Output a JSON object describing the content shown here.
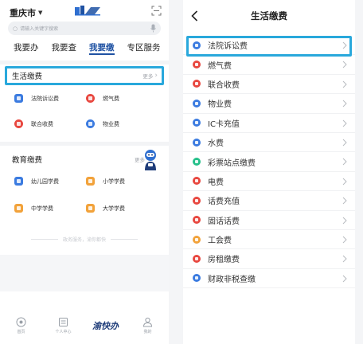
{
  "left": {
    "city": "重庆市",
    "search_placeholder": "请输入关键字搜索",
    "tabs": [
      "我要办",
      "我要查",
      "我要缴",
      "专区服务"
    ],
    "active_tab": 2,
    "life": {
      "title": "生活缴费",
      "more": "更多",
      "items": [
        {
          "label": "法院诉讼费",
          "color": "#3b7be0"
        },
        {
          "label": "燃气费",
          "color": "#e8473f"
        },
        {
          "label": "联合收费",
          "color": "#e8473f"
        },
        {
          "label": "物业费",
          "color": "#3b7be0"
        }
      ]
    },
    "edu": {
      "title": "教育缴费",
      "more": "更多",
      "items": [
        {
          "label": "幼儿园学费",
          "color": "#3b7be0"
        },
        {
          "label": "小学学费",
          "color": "#f2a23a"
        },
        {
          "label": "中学学费",
          "color": "#f2a23a"
        },
        {
          "label": "大学学费",
          "color": "#f2a23a"
        }
      ]
    },
    "footer_note": "政务服务，渝你都快",
    "bottom_nav": [
      {
        "label": "首页",
        "icon": "home-icon"
      },
      {
        "label": "个人中心",
        "icon": "card-icon"
      },
      {
        "label": "渝快办",
        "icon": "logo"
      },
      {
        "label": "我的",
        "icon": "user-icon"
      }
    ]
  },
  "right": {
    "title": "生活缴费",
    "items": [
      {
        "label": "法院诉讼费",
        "color": "#3b7be0"
      },
      {
        "label": "燃气费",
        "color": "#e8473f"
      },
      {
        "label": "联合收费",
        "color": "#e8473f"
      },
      {
        "label": "物业费",
        "color": "#3b7be0"
      },
      {
        "label": "IC卡充值",
        "color": "#3b7be0"
      },
      {
        "label": "水费",
        "color": "#3b7be0"
      },
      {
        "label": "彩票站点缴费",
        "color": "#25c08a"
      },
      {
        "label": "电费",
        "color": "#e8473f"
      },
      {
        "label": "话费充值",
        "color": "#e8473f"
      },
      {
        "label": "固话话费",
        "color": "#e8473f"
      },
      {
        "label": "工会费",
        "color": "#f2a23a"
      },
      {
        "label": "房租缴费",
        "color": "#e8473f"
      },
      {
        "label": "财政非税查缴",
        "color": "#3b7be0"
      }
    ]
  },
  "colors": {
    "accent": "#1f52a3",
    "highlight": "#29a8dc"
  }
}
